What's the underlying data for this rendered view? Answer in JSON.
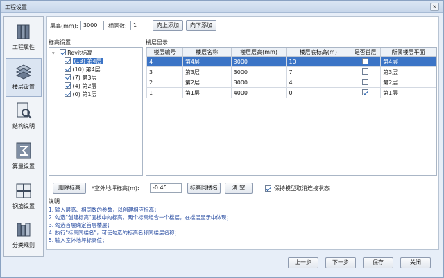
{
  "window": {
    "title": "工程设置",
    "close_glyph": "×"
  },
  "sidebar": {
    "items": [
      {
        "label": "工程属性",
        "icon": "books-icon"
      },
      {
        "label": "楼层设置",
        "icon": "layers-icon"
      },
      {
        "label": "结构说明",
        "icon": "document-search-icon"
      },
      {
        "label": "算量设置",
        "icon": "sigma-icon"
      },
      {
        "label": "钢筋设置",
        "icon": "rebar-icon"
      },
      {
        "label": "分类规则",
        "icon": "category-icon"
      }
    ]
  },
  "top_form": {
    "floor_height_label": "层高(mm):",
    "floor_height_value": "3000",
    "same_count_label": "相同数:",
    "same_count_value": "1",
    "add_above_label": "向上添加",
    "add_below_label": "向下添加"
  },
  "elevation_tree": {
    "heading": "标高设置",
    "root_label": "Revit标高",
    "items": [
      {
        "label": "(13) 第4层",
        "selected": true
      },
      {
        "label": "(10) 第4层",
        "selected": false
      },
      {
        "label": "(7) 第3层",
        "selected": false
      },
      {
        "label": "(4) 第2层",
        "selected": false
      },
      {
        "label": "(0) 第1层",
        "selected": false
      }
    ]
  },
  "floor_display": {
    "heading": "楼层显示",
    "columns": [
      "楼层编号",
      "楼层名称",
      "楼层层高(mm)",
      "楼层底标高(m)",
      "是否首层",
      "所属楼层平面"
    ],
    "rows": [
      {
        "num": "4",
        "name": "第4层",
        "height": "3000",
        "bottom": "10",
        "is_first": false,
        "plane": "第4层",
        "selected": true
      },
      {
        "num": "3",
        "name": "第3层",
        "height": "3000",
        "bottom": "7",
        "is_first": false,
        "plane": "第3层",
        "selected": false
      },
      {
        "num": "2",
        "name": "第2层",
        "height": "3000",
        "bottom": "4",
        "is_first": false,
        "plane": "第2层",
        "selected": false
      },
      {
        "num": "1",
        "name": "第1层",
        "height": "4000",
        "bottom": "0",
        "is_first": true,
        "plane": "第1层",
        "selected": false
      }
    ]
  },
  "bottom_controls": {
    "delete_elevation_label": "删除标高",
    "outdoor_label": "*室外地坪标高(m):",
    "outdoor_value": "-0.45",
    "rename_label": "标高同楼名",
    "clear_label": "清 空",
    "keep_model_label": "保持模型取消连接状态",
    "keep_model_checked": true
  },
  "notes": {
    "heading": "说明",
    "lines": [
      "1. 输入层高、相同数的参数，以创建相应标高；",
      "2. 勾选\"创建标高\"面板中的标高，两个标高组合一个楼层，在楼层显示中体现；",
      "3. 勾选首层确定首层楼层；",
      "4. 执行\"标高同楼名\"，可使勾选的标高名称同楼层名称；",
      "5. 输入室外地坪标高值；"
    ]
  },
  "footer": {
    "prev_label": "上一步",
    "next_label": "下一步",
    "save_label": "保存",
    "close_label": "关闭"
  }
}
